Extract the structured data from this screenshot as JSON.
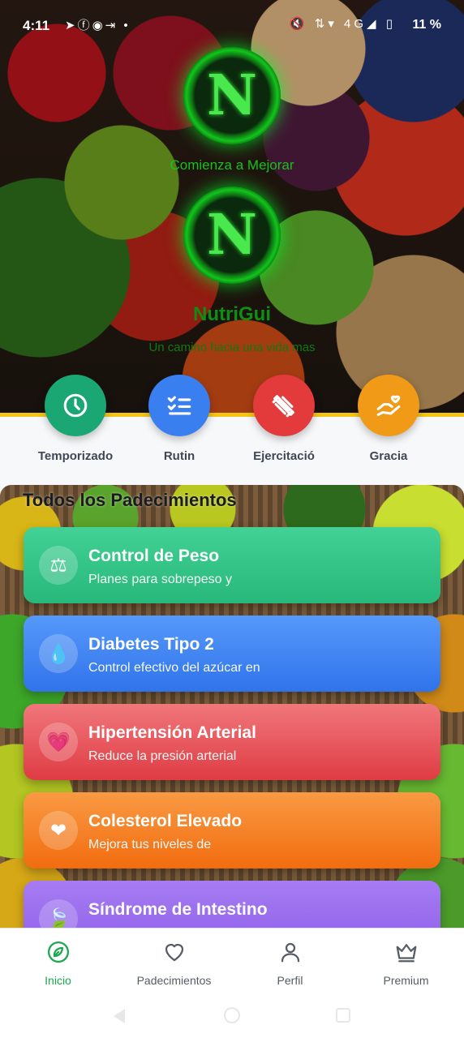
{
  "status": {
    "time": "4:11",
    "left_icons": "➤ⓕ◉⇥ •",
    "right_icons": "🔇 ⇅▾ 4G◢ ▯",
    "battery": "11 %"
  },
  "hero": {
    "logo_letter": "N",
    "tagline": "Comienza a Mejorar",
    "app_name": "NutriGui",
    "subtitle": "Un camino hacia una vida mas"
  },
  "quick_actions": [
    {
      "label": "Temporizado",
      "icon": "clock-icon",
      "color": "#1aa774"
    },
    {
      "label": "Rutin",
      "icon": "checklist-icon",
      "color": "#3a7ff0"
    },
    {
      "label": "Ejercitació",
      "icon": "dumbbell-icon",
      "color": "#e33a3b"
    },
    {
      "label": "Gracia",
      "icon": "hand-heart-icon",
      "color": "#f19a17"
    }
  ],
  "section": {
    "title": "Todos los Padecimientos",
    "cards": [
      {
        "title": "Control de Peso",
        "desc": "Planes para sobrepeso y",
        "icon": "⚖",
        "color": "#2fc185"
      },
      {
        "title": "Diabetes Tipo 2",
        "desc": "Control efectivo del azúcar en",
        "icon": "💧",
        "color": "#3f82f2"
      },
      {
        "title": "Hipertensión Arterial",
        "desc": "Reduce la presión arterial",
        "icon": "💗",
        "color": "#e5494f"
      },
      {
        "title": "Colesterol Elevado",
        "desc": "Mejora tus niveles de",
        "icon": "❤",
        "color": "#f57d20"
      },
      {
        "title": "Síndrome de Intestino",
        "desc": "",
        "icon": "🍃",
        "color": "#9368ec"
      }
    ]
  },
  "bottom_nav": [
    {
      "label": "Inicio",
      "icon": "home-icon",
      "active": true
    },
    {
      "label": "Padecimientos",
      "icon": "heart-icon",
      "active": false
    },
    {
      "label": "Perfil",
      "icon": "user-icon",
      "active": false
    },
    {
      "label": "Premium",
      "icon": "crown-icon",
      "active": false
    }
  ],
  "colors": {
    "accent_green": "#1aa84e",
    "divider_yellow": "#f3c614"
  }
}
